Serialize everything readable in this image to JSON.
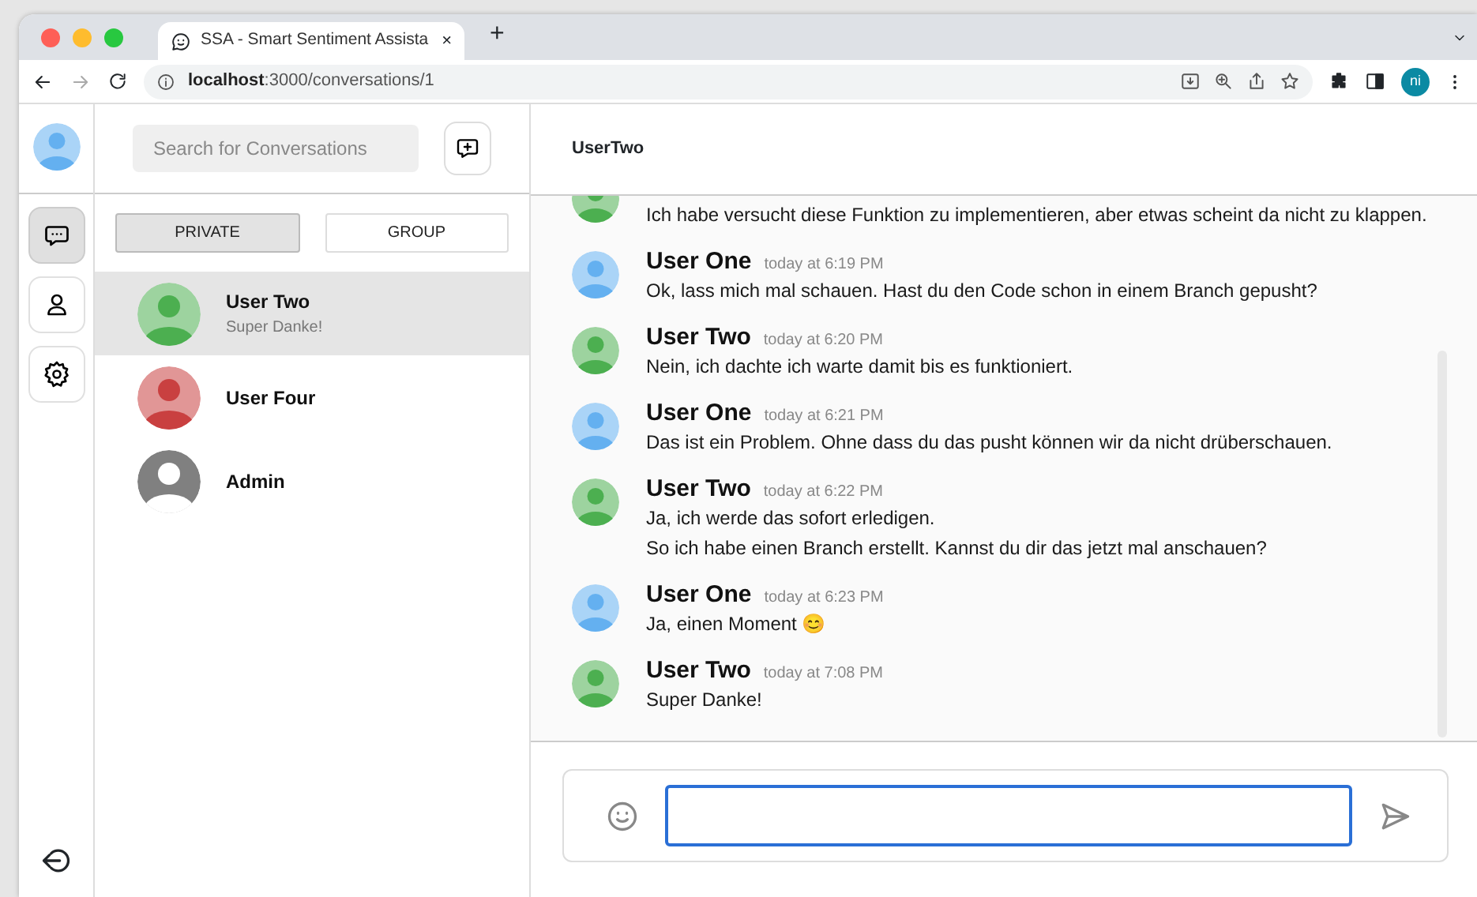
{
  "browser": {
    "tab_title": "SSA - Smart Sentiment Assista",
    "tab_close": "×",
    "new_tab": "+",
    "url": "**localhost**:3000/conversations/1",
    "profile": "ni"
  },
  "rail": {
    "items": [
      {
        "kind": "chats",
        "selected": true
      },
      {
        "kind": "contacts",
        "selected": false
      },
      {
        "kind": "settings",
        "selected": false
      }
    ]
  },
  "conversations": {
    "search": {
      "placeholder": "Search for Conversations"
    },
    "tabs": [
      {
        "label": "PRIVATE",
        "selected": true
      },
      {
        "label": "GROUP",
        "selected": false
      }
    ],
    "items": [
      {
        "name": "User Two",
        "preview": "Super Danke!",
        "color": "#4caf50",
        "selected": true
      },
      {
        "name": "User Four",
        "color": "#c94040",
        "selected": false
      },
      {
        "name": "Admin",
        "color": "#808080",
        "selected": false
      }
    ]
  },
  "chat": {
    "title": "UserTwo",
    "messages": [
      {
        "color": "#4caf50",
        "lines": [
          "Ich habe versucht diese Funktion zu implementieren, aber etwas scheint da nicht zu klappen."
        ]
      },
      {
        "sender": "User One",
        "time": "today at 6:19 PM",
        "color": "#64b0f0",
        "lines": [
          "Ok, lass mich mal schauen. Hast du den Code schon in einem Branch gepusht?"
        ]
      },
      {
        "sender": "User Two",
        "time": "today at 6:20 PM",
        "color": "#4caf50",
        "lines": [
          "Nein, ich dachte ich warte damit bis es funktioniert."
        ]
      },
      {
        "sender": "User One",
        "time": "today at 6:21 PM",
        "color": "#64b0f0",
        "lines": [
          "Das ist ein Problem. Ohne dass du das pusht können wir da nicht drüberschauen."
        ]
      },
      {
        "sender": "User Two",
        "time": "today at 6:22 PM",
        "color": "#4caf50",
        "lines": [
          "Ja, ich werde das sofort erledigen.",
          "So ich habe einen Branch erstellt. Kannst du dir das jetzt mal anschauen?"
        ]
      },
      {
        "sender": "User One",
        "time": "today at 6:23 PM",
        "color": "#64b0f0",
        "lines": [
          "Ja, einen Moment 😊"
        ]
      },
      {
        "sender": "User Two",
        "time": "today at 7:08 PM",
        "color": "#4caf50",
        "lines": [
          "Super Danke!"
        ]
      }
    ]
  }
}
